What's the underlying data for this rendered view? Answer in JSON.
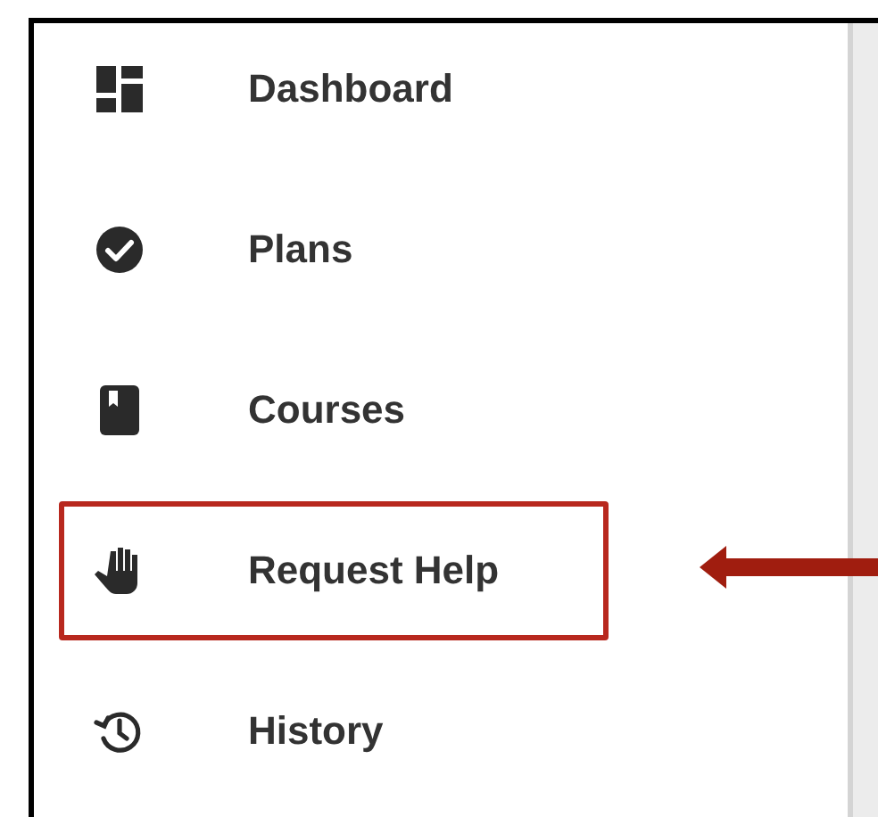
{
  "sidebar": {
    "items": [
      {
        "label": "Dashboard",
        "kind": "dashboard",
        "highlighted": false
      },
      {
        "label": "Plans",
        "kind": "plans",
        "highlighted": false
      },
      {
        "label": "Courses",
        "kind": "courses",
        "highlighted": false
      },
      {
        "label": "Request Help",
        "kind": "help",
        "highlighted": true
      },
      {
        "label": "History",
        "kind": "history",
        "highlighted": false
      }
    ]
  }
}
